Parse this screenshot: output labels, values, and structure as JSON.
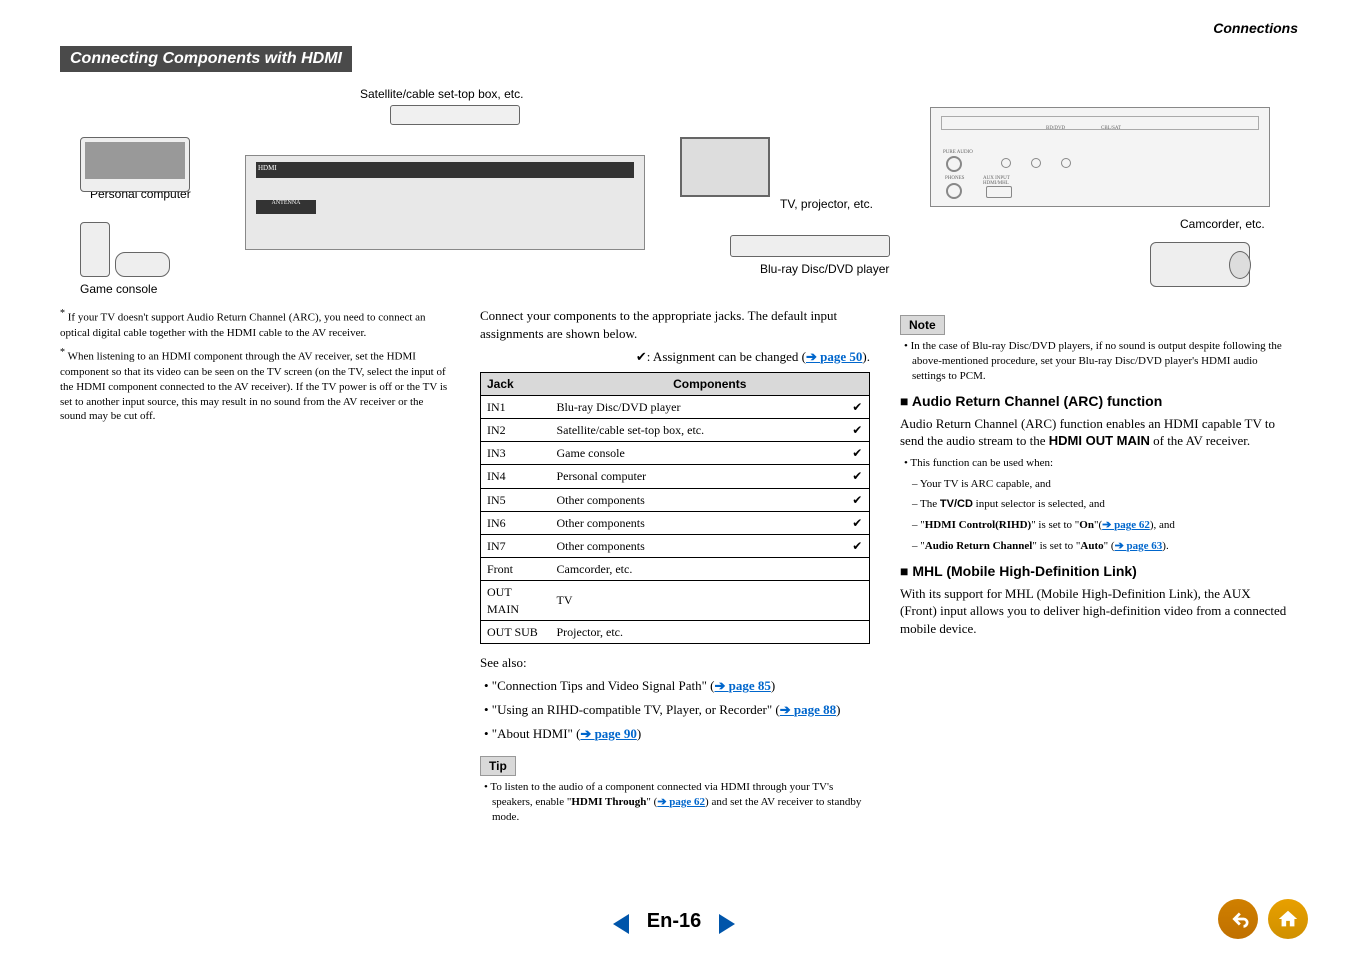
{
  "header": {
    "breadcrumb": "Connections"
  },
  "section_title": "Connecting Components with HDMI",
  "diagram": {
    "satellite_label": "Satellite/cable set-top box, etc.",
    "pc_label": "Personal computer",
    "game_label": "Game console",
    "tv_label": "TV, projector, etc.",
    "bluray_label": "Blu-ray Disc/DVD player",
    "camcorder_label": "Camcorder, etc."
  },
  "left": {
    "note1": "If your TV doesn't support Audio Return Channel (ARC), you need to connect an optical digital cable together with the HDMI cable to the AV receiver.",
    "note2": "When listening to an HDMI component through the AV receiver, set the HDMI component so that its video can be seen on the TV screen (on the TV, select the input of the HDMI component connected to the AV receiver). If the TV power is off or the TV is set to another input source, this may result in no sound from the AV receiver or the sound may be cut off."
  },
  "center": {
    "intro": "Connect your components to the appropriate jacks. The default input assignments are shown below.",
    "legend_pre": "✔: Assignment can be changed (",
    "legend_link": "page 50",
    "legend_post": ").",
    "th_jack": "Jack",
    "th_comp": "Components",
    "rows": [
      {
        "j": "IN1",
        "c": "Blu-ray Disc/DVD player",
        "m": "✔"
      },
      {
        "j": "IN2",
        "c": "Satellite/cable set-top box, etc.",
        "m": "✔"
      },
      {
        "j": "IN3",
        "c": "Game console",
        "m": "✔"
      },
      {
        "j": "IN4",
        "c": "Personal computer",
        "m": "✔"
      },
      {
        "j": "IN5",
        "c": "Other components",
        "m": "✔"
      },
      {
        "j": "IN6",
        "c": "Other components",
        "m": "✔"
      },
      {
        "j": "IN7",
        "c": "Other components",
        "m": "✔"
      },
      {
        "j": "Front",
        "c": "Camcorder, etc.",
        "m": ""
      },
      {
        "j": "OUT MAIN",
        "c": "TV",
        "m": ""
      },
      {
        "j": "OUT SUB",
        "c": "Projector, etc.",
        "m": ""
      }
    ],
    "see_also": "See also:",
    "sa1_pre": "• \"Connection Tips and Video Signal Path\" (",
    "sa1_link": "page 85",
    "sa2_pre": "• \"Using an RIHD-compatible TV, Player, or Recorder\" (",
    "sa2_link": "page 88",
    "sa3_pre": "• \"About HDMI\" (",
    "sa3_link": "page 90",
    "close_paren": ")",
    "tip_label": "Tip",
    "tip_pre": "• To listen to the audio of a component connected via HDMI through your TV's speakers, enable \"",
    "tip_bold": "HDMI Through",
    "tip_mid": "\" (",
    "tip_link": "page 62",
    "tip_post": ") and set the AV receiver to standby mode."
  },
  "right": {
    "note_label": "Note",
    "note_text": "• In the case of Blu-ray Disc/DVD players, if no sound is output despite following the above-mentioned procedure, set your Blu-ray Disc/DVD player's HDMI audio settings to PCM.",
    "arc_heading": "Audio Return Channel (ARC) function",
    "arc_p1_a": "Audio Return Channel (ARC) function enables an HDMI capable TV to send the audio stream to the ",
    "arc_p1_b": "HDMI OUT MAIN",
    "arc_p1_c": " of the AV receiver.",
    "arc_b1": "• This function can be used when:",
    "arc_d1": "– Your TV is ARC capable, and",
    "arc_d2_a": "– The ",
    "arc_d2_b": "TV/CD",
    "arc_d2_c": " input selector is selected, and",
    "arc_d3_a": "– \"",
    "arc_d3_b": "HDMI Control(RIHD)",
    "arc_d3_c": "\" is set to \"",
    "arc_d3_d": "On",
    "arc_d3_e": "\"(",
    "arc_d3_link": "page 62",
    "arc_d3_f": "), and",
    "arc_d4_a": "– \"",
    "arc_d4_b": "Audio Return Channel",
    "arc_d4_c": "\" is set to \"",
    "arc_d4_d": "Auto",
    "arc_d4_e": "\" (",
    "arc_d4_link": "page 63",
    "arc_d4_f": ").",
    "mhl_heading": "MHL (Mobile High-Definition Link)",
    "mhl_text": "With its support for MHL (Mobile High-Definition Link), the AUX (Front) input allows you to deliver high-definition video from a connected mobile device."
  },
  "footer": {
    "page": "En-16"
  }
}
